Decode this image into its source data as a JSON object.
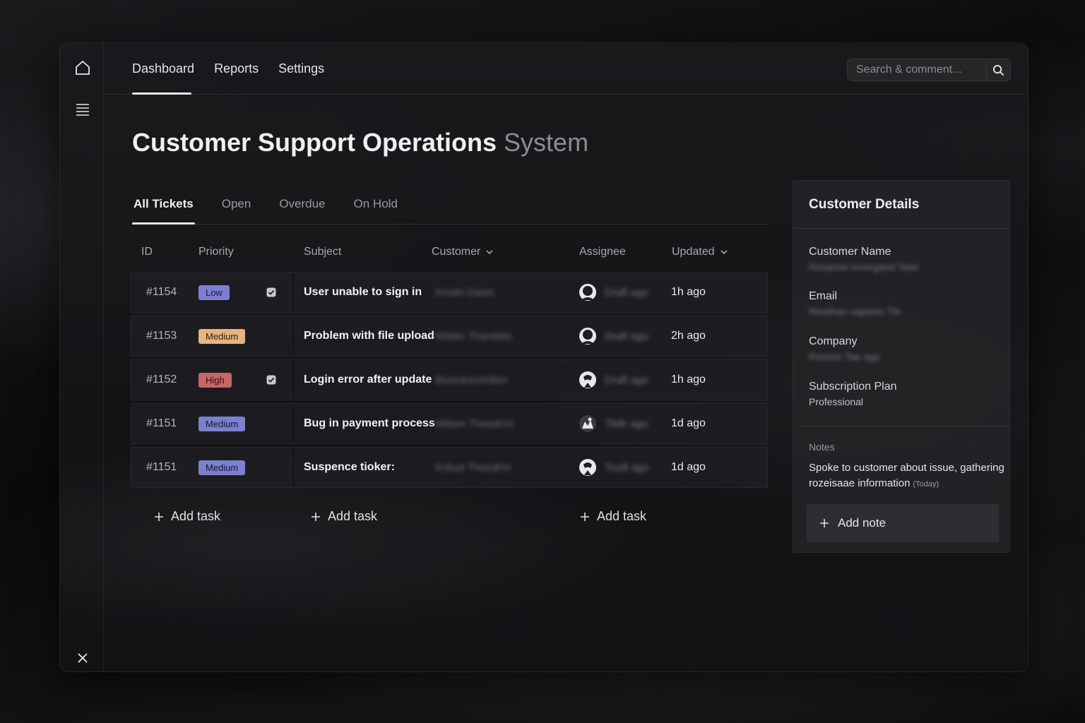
{
  "nav": {
    "items": [
      {
        "label": "Dashboard",
        "active": true
      },
      {
        "label": "Reports",
        "active": false
      },
      {
        "label": "Settings",
        "active": false
      }
    ]
  },
  "search": {
    "placeholder": "Search & comment..."
  },
  "page": {
    "title": "Customer Support Operations",
    "title_suffix": "System"
  },
  "tabs": [
    {
      "label": "All Tickets",
      "active": true
    },
    {
      "label": "Open",
      "active": false
    },
    {
      "label": "Overdue",
      "active": false
    },
    {
      "label": "On Hold",
      "active": false
    }
  ],
  "table": {
    "columns": {
      "id": "ID",
      "priority": "Priority",
      "subject": "Subject",
      "customer": "Customer",
      "assignee": "Assignee",
      "updated": "Updated"
    },
    "rows": [
      {
        "id": "#1154",
        "priority": "Low",
        "checked": true,
        "subject": "User unable to sign in",
        "customer": "Kristin Davis",
        "assignee": "Draft ago",
        "updated": "1h ago"
      },
      {
        "id": "#1153",
        "priority": "Medium",
        "checked": false,
        "subject": "Problem with file upload",
        "customer": "Wilder Thambtts",
        "assignee": "Draft ago",
        "updated": "2h ago"
      },
      {
        "id": "#1152",
        "priority": "High",
        "checked": true,
        "subject": "Login error after update",
        "customer": "Bixerarenmillen",
        "assignee": "Draft ago",
        "updated": "1h ago"
      },
      {
        "id": "#1151",
        "priority": "Medium",
        "checked": false,
        "subject": "Bug in payment process",
        "customer": "Miliam Theeds'in",
        "assignee": "Tildh ago",
        "updated": "1d ago"
      },
      {
        "id": "#1151",
        "priority": "Medium",
        "checked": false,
        "subject": "Suspence tioker:",
        "customer": "Kriloul Theedt'in",
        "assignee": "Trudi ago",
        "updated": "1d ago"
      }
    ],
    "add_task_label": "Add task"
  },
  "panel": {
    "title": "Customer Details",
    "fields": [
      {
        "label": "Customer Name",
        "value": "Rosanne Invergand Tase"
      },
      {
        "label": "Email",
        "value": "Rissthan xapions Tfe"
      },
      {
        "label": "Company",
        "value": "Rosson Tae ago"
      },
      {
        "label": "Subscription Plan",
        "value": "Professional"
      }
    ],
    "notes_label": "Notes",
    "note_text": "Spoke to customer about issue, gathering rozeisaae information",
    "note_when": "(Today)",
    "add_note_label": "Add note"
  },
  "colors": {
    "low": "#7c7fd1",
    "medium": "#e8b382",
    "medium_alt": "#7b80cf",
    "high": "#c96565"
  },
  "icons": [
    "home-icon",
    "menu-icon",
    "close-icon",
    "search-icon",
    "check-icon",
    "chevron-down-icon",
    "plus-icon",
    "avatar-icon"
  ]
}
